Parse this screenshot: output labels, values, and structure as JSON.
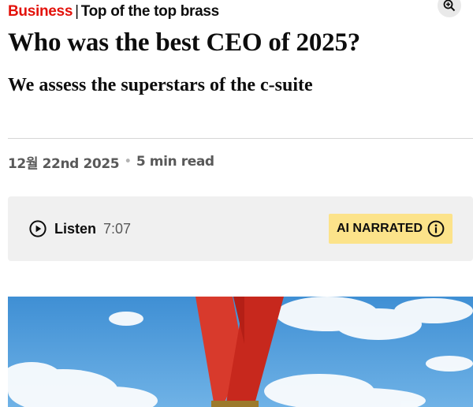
{
  "header": {
    "section": "Business",
    "divider": "|",
    "fly_title": "Top of the top brass",
    "zoom_icon": "zoom-in-icon"
  },
  "article": {
    "headline": "Who was the best CEO of 2025?",
    "subheadline": "We assess the superstars of the c-suite",
    "date": "12월 22nd 2025",
    "separator": "•",
    "read_time": "5 min read"
  },
  "audio": {
    "play_icon": "play-circle-icon",
    "listen_label": "Listen",
    "duration": "7:07",
    "ai_badge_label": "AI NARRATED",
    "info_icon": "info-circle-icon"
  },
  "hero_image": {
    "description_icon": "medal-ribbon-sky-image"
  },
  "colors": {
    "section_red": "#e3120b",
    "badge_yellow": "#fce38a",
    "audio_bar_bg": "#f0f0f0",
    "meta_gray": "#595959"
  }
}
